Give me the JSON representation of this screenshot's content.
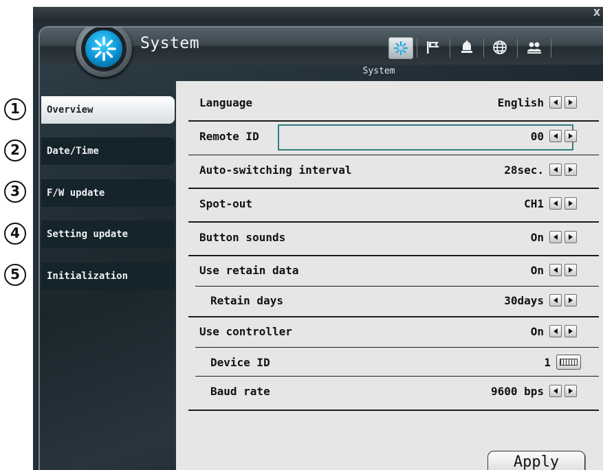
{
  "window": {
    "close_label": "X"
  },
  "header": {
    "title": "System",
    "subtitle": "System"
  },
  "toolbar_icons": [
    "system-icon",
    "flag-icon",
    "alarm-bell-icon",
    "network-globe-icon",
    "users-icon"
  ],
  "markers": [
    "1",
    "2",
    "3",
    "4",
    "5"
  ],
  "tabs": [
    {
      "label": "Overview",
      "active": true
    },
    {
      "label": "Date/Time",
      "active": false
    },
    {
      "label": "F/W update",
      "active": false
    },
    {
      "label": "Setting update",
      "active": false
    },
    {
      "label": "Initialization",
      "active": false
    }
  ],
  "settings": [
    {
      "label": "Language",
      "value": "English",
      "control": "arrows"
    },
    {
      "label": "Remote ID",
      "value": "00",
      "control": "arrows",
      "focused": true
    },
    {
      "label": "Auto-switching interval",
      "value": "28sec.",
      "control": "arrows"
    },
    {
      "label": "Spot-out",
      "value": "CH1",
      "control": "arrows"
    },
    {
      "label": "Button sounds",
      "value": "On",
      "control": "arrows"
    },
    {
      "label": "Use retain data",
      "value": "On",
      "control": "arrows"
    },
    {
      "label": "Retain days",
      "value": "30days",
      "control": "arrows",
      "indent": true
    },
    {
      "label": "Use controller",
      "value": "On",
      "control": "arrows"
    },
    {
      "label": "Device ID",
      "value": "1",
      "control": "keyboard",
      "indent": true
    },
    {
      "label": "Baud rate",
      "value": "9600 bps",
      "control": "arrows",
      "indent": true
    }
  ],
  "apply_label": "Apply",
  "colors": {
    "accent": "#1aa8e6",
    "focus_border": "#2e7f80",
    "panel_bg": "#e6e6e6",
    "tab_bg": "#15232b"
  }
}
